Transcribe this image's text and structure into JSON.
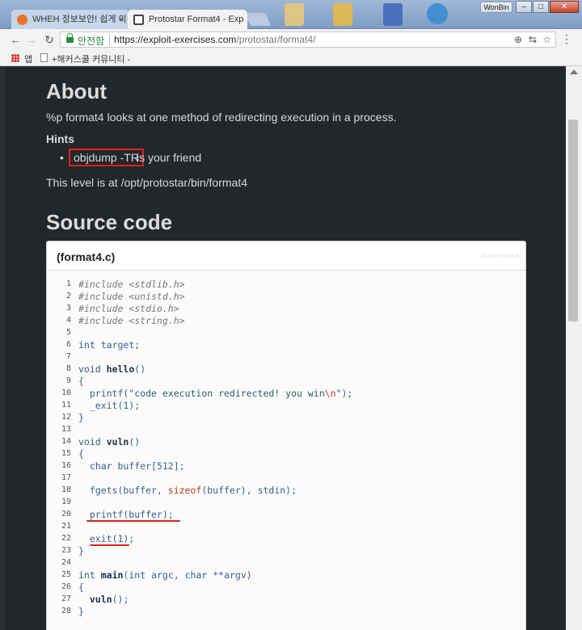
{
  "browser": {
    "tabs": [
      {
        "title": "WHEH 정보보안! 쉽게 이"
      },
      {
        "title": "Protostar Format4 - Exp"
      }
    ],
    "user_name": "WonBin",
    "address": {
      "secure_label": "안전함",
      "url_host": "https://exploit-exercises.com",
      "url_path": "/protostar/format4/"
    },
    "bookmarks": [
      {
        "label": "앱"
      },
      {
        "label": "+해커스쿨 커뮤니티 -"
      }
    ],
    "icons": {
      "back": "arrow-left-icon",
      "forward": "arrow-right-icon",
      "reload": "reload-icon",
      "zoom": "zoom-icon",
      "translate": "translate-icon",
      "star": "star-icon",
      "menu": "kebab-menu-icon"
    }
  },
  "page": {
    "about_heading": "About",
    "about_text": "%p format4 looks at one method of redirecting execution in a process.",
    "hints_heading": "Hints",
    "hint_highlight": "objdump -TR",
    "hint_rest": "is your friend",
    "level_text": "This level is at /opt/protostar/bin/format4",
    "source_heading": "Source code",
    "code_filename": "(format4.c)",
    "code_download": "download",
    "code_lines": [
      "#include <stdlib.h>",
      "#include <unistd.h>",
      "#include <stdio.h>",
      "#include <string.h>",
      "",
      "int target;",
      "",
      "void hello()",
      "{",
      "  printf(\"code execution redirected! you win\\n\");",
      "  _exit(1);",
      "}",
      "",
      "void vuln()",
      "{",
      "  char buffer[512];",
      "",
      "  fgets(buffer, sizeof(buffer), stdin);",
      "",
      "  printf(buffer);",
      "",
      "  exit(1);",
      "}",
      "",
      "int main(int argc, char **argv)",
      "{",
      "  vuln();",
      "}"
    ],
    "annotations": {
      "highlight_color": "#e02020"
    }
  }
}
